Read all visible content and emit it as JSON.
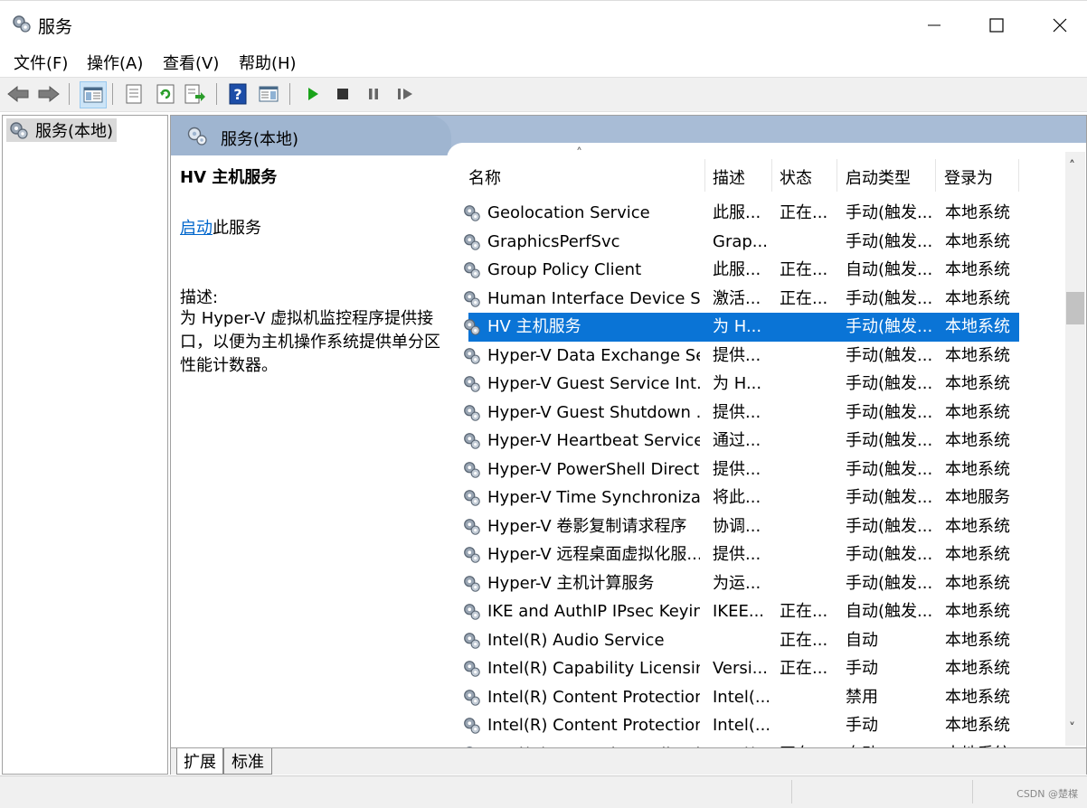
{
  "window": {
    "title": "服务",
    "minimize_glyph": "—",
    "maximize_glyph": "☐",
    "close_glyph": "✕"
  },
  "menu": [
    "文件(F)",
    "操作(A)",
    "查看(V)",
    "帮助(H)"
  ],
  "toolbar_icons": [
    "back-arrow-icon",
    "forward-arrow-icon",
    "show-hide-console-tree-icon",
    "properties-icon",
    "refresh-icon",
    "export-list-icon",
    "help-icon",
    "show-hide-action-pane-icon",
    "start-service-icon",
    "stop-service-icon",
    "pause-service-icon",
    "restart-service-icon"
  ],
  "tree": {
    "root_label": "服务(本地)"
  },
  "pane": {
    "header_title": "服务(本地)",
    "selected_service_name": "HV 主机服务",
    "start_link": "启动",
    "start_suffix": "此服务",
    "desc_label": "描述:",
    "desc_text": "为 Hyper-V 虚拟机监控程序提供接口，以便为主机操作系统提供单分区性能计数器。"
  },
  "table": {
    "sort_glyph": "˄",
    "columns": [
      "名称",
      "描述",
      "状态",
      "启动类型",
      "登录为"
    ],
    "rows": [
      {
        "name": "Geolocation Service",
        "desc": "此服...",
        "status": "正在...",
        "startup": "手动(触发...",
        "logon": "本地系统"
      },
      {
        "name": "GraphicsPerfSvc",
        "desc": "Grap...",
        "status": "",
        "startup": "手动(触发...",
        "logon": "本地系统"
      },
      {
        "name": "Group Policy Client",
        "desc": "此服...",
        "status": "正在...",
        "startup": "自动(触发...",
        "logon": "本地系统"
      },
      {
        "name": "Human Interface Device S...",
        "desc": "激活...",
        "status": "正在...",
        "startup": "手动(触发...",
        "logon": "本地系统"
      },
      {
        "name": "HV 主机服务",
        "desc": "为 H...",
        "status": "",
        "startup": "手动(触发...",
        "logon": "本地系统",
        "selected": true
      },
      {
        "name": "Hyper-V Data Exchange Se...",
        "desc": "提供...",
        "status": "",
        "startup": "手动(触发...",
        "logon": "本地系统"
      },
      {
        "name": "Hyper-V Guest Service Int...",
        "desc": "为 H...",
        "status": "",
        "startup": "手动(触发...",
        "logon": "本地系统"
      },
      {
        "name": "Hyper-V Guest Shutdown ...",
        "desc": "提供...",
        "status": "",
        "startup": "手动(触发...",
        "logon": "本地系统"
      },
      {
        "name": "Hyper-V Heartbeat Service",
        "desc": "通过...",
        "status": "",
        "startup": "手动(触发...",
        "logon": "本地系统"
      },
      {
        "name": "Hyper-V PowerShell Direct...",
        "desc": "提供...",
        "status": "",
        "startup": "手动(触发...",
        "logon": "本地系统"
      },
      {
        "name": "Hyper-V Time Synchroniza...",
        "desc": "将此...",
        "status": "",
        "startup": "手动(触发...",
        "logon": "本地服务"
      },
      {
        "name": "Hyper-V 卷影复制请求程序",
        "desc": "协调...",
        "status": "",
        "startup": "手动(触发...",
        "logon": "本地系统"
      },
      {
        "name": "Hyper-V 远程桌面虚拟化服...",
        "desc": "提供...",
        "status": "",
        "startup": "手动(触发...",
        "logon": "本地系统"
      },
      {
        "name": "Hyper-V 主机计算服务",
        "desc": "为运...",
        "status": "",
        "startup": "手动(触发...",
        "logon": "本地系统"
      },
      {
        "name": "IKE and AuthIP IPsec Keyin...",
        "desc": "IKEE...",
        "status": "正在...",
        "startup": "自动(触发...",
        "logon": "本地系统"
      },
      {
        "name": "Intel(R) Audio Service",
        "desc": "",
        "status": "正在...",
        "startup": "自动",
        "logon": "本地系统"
      },
      {
        "name": "Intel(R) Capability Licensin...",
        "desc": "Versi...",
        "status": "正在...",
        "startup": "手动",
        "logon": "本地系统"
      },
      {
        "name": "Intel(R) Content Protection...",
        "desc": "Intel(...",
        "status": "",
        "startup": "禁用",
        "logon": "本地系统"
      },
      {
        "name": "Intel(R) Content Protection...",
        "desc": "Intel(...",
        "status": "",
        "startup": "手动",
        "logon": "本地系统"
      },
      {
        "name": "Intel(R) Dynamic Applicati...",
        "desc": "Intel(...",
        "status": "正在...",
        "startup": "自动",
        "logon": "本地系统"
      }
    ]
  },
  "scroll": {
    "up_glyph": "˄",
    "down_glyph": "˅"
  },
  "tabs": [
    "扩展",
    "标准"
  ],
  "watermark": "CSDN @楚楳",
  "colors": {
    "selection": "#0a74d6",
    "header_blue": "#a8bcd6",
    "link": "#0066cc"
  }
}
